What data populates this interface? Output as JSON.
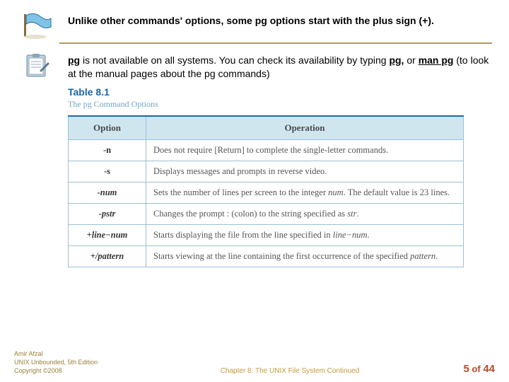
{
  "note1": {
    "text": "Unlike other commands' options, some pg options start with the plus sign (+)."
  },
  "note2": {
    "lead1": "pg",
    "part1": " is not available on all systems. You can check its availability by typing ",
    "lead2": "pg,",
    "part2": " or ",
    "lead3": "man pg",
    "part3": " (to look at the manual pages about the pg commands)"
  },
  "table": {
    "title": "Table 8.1",
    "subtitle": "The pg Command Options",
    "headers": {
      "option": "Option",
      "operation": "Operation"
    },
    "rows": [
      {
        "option": "-n",
        "operation_pre": "Does not require [Return] to complete the single-letter commands.",
        "ital": "",
        "operation_post": ""
      },
      {
        "option": "-s",
        "operation_pre": "Displays messages and prompts in reverse video.",
        "ital": "",
        "operation_post": ""
      },
      {
        "option": "-num",
        "operation_pre": "Sets the number of lines per screen to the integer ",
        "ital": "num",
        "operation_post": ". The default value is 23 lines."
      },
      {
        "option": "-pstr",
        "operation_pre": "Changes the prompt : (colon) to the string specified as ",
        "ital": "str",
        "operation_post": "."
      },
      {
        "option": "+line−num",
        "operation_pre": "Starts displaying the file from the line specified in ",
        "ital": "line−num",
        "operation_post": "."
      },
      {
        "option": "+/pattern",
        "operation_pre": "Starts viewing at the line containing the first occurrence of the specified ",
        "ital": "pattern",
        "operation_post": "."
      }
    ]
  },
  "footer": {
    "author": "Amir Afzal",
    "book": "UNIX Unbounded, 5th Edition",
    "copyright": "Copyright ©2008",
    "chapter": "Chapter 8: The UNIX File System Continued",
    "page_current": "5",
    "page_of": " of ",
    "page_total": "44"
  }
}
